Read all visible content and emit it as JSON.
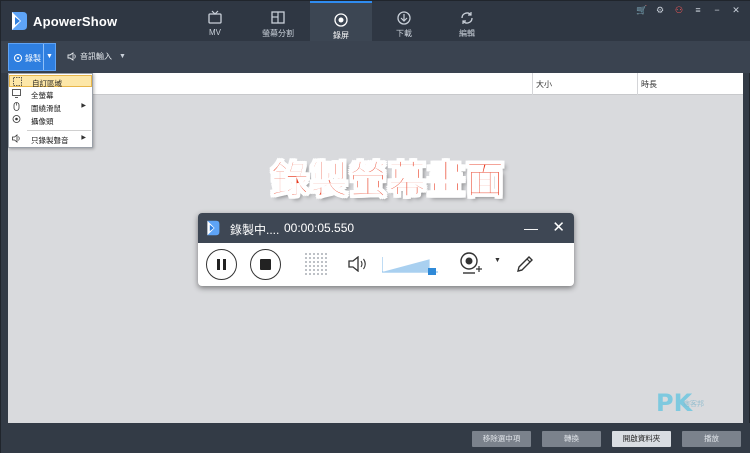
{
  "app": {
    "title": "ApowerShow"
  },
  "tabs": [
    {
      "label": "MV",
      "icon": "tv-icon"
    },
    {
      "label": "螢幕分割",
      "icon": "split-screen-icon"
    },
    {
      "label": "錄屏",
      "icon": "record-icon",
      "active": true
    },
    {
      "label": "下載",
      "icon": "download-icon"
    },
    {
      "label": "編輯",
      "icon": "refresh-icon"
    }
  ],
  "toolbar": {
    "record_label": "錄製",
    "audio_label": "音訊輸入"
  },
  "list": {
    "columns": [
      "大小",
      "時長"
    ]
  },
  "menu": {
    "items": [
      {
        "label": "自訂區域",
        "icon": "custom-area-icon",
        "active": true
      },
      {
        "label": "全螢幕",
        "icon": "monitor-icon"
      },
      {
        "label": "圍繞滑鼠",
        "icon": "mouse-icon",
        "submenu": true
      },
      {
        "label": "攝像頭",
        "icon": "webcam-icon"
      },
      {
        "label": "只錄製聲音",
        "icon": "audio-only-icon",
        "submenu": true
      }
    ]
  },
  "caption": "錄製螢幕畫面",
  "recorder": {
    "status": "錄製中....",
    "time": "00:00:05.550",
    "volume_level": 0.85
  },
  "bottom_buttons": [
    "移除選中項",
    "轉換",
    "開啟資料夾",
    "播放"
  ],
  "watermark": {
    "brand": "PK",
    "sub": "痞客邦"
  },
  "colors": {
    "accent": "#2f7fe0",
    "caption": "#e8371c",
    "menu_highlight": "#fde7a8"
  }
}
